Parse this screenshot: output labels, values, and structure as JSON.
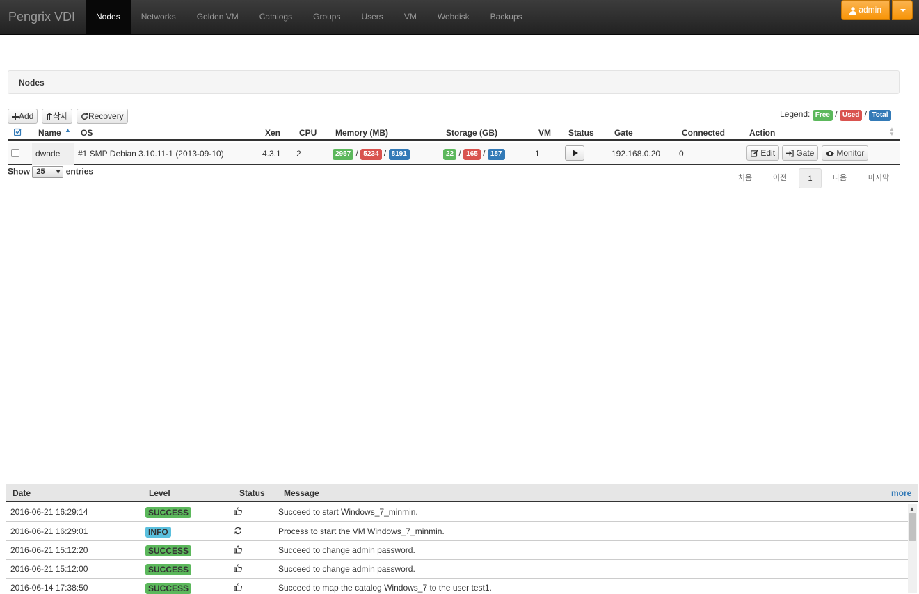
{
  "navbar": {
    "brand": "Pengrix VDI",
    "items": [
      {
        "label": "Nodes",
        "active": true
      },
      {
        "label": "Networks"
      },
      {
        "label": "Golden VM"
      },
      {
        "label": "Catalogs"
      },
      {
        "label": "Groups"
      },
      {
        "label": "Users"
      },
      {
        "label": "VM"
      },
      {
        "label": "Webdisk"
      },
      {
        "label": "Backups"
      }
    ],
    "user_label": "admin"
  },
  "page_title": "Nodes",
  "toolbar": {
    "add_label": "Add",
    "delete_label": "삭제",
    "recovery_label": "Recovery"
  },
  "legend": {
    "label": "Legend:",
    "free": "Free",
    "used": "Used",
    "total": "Total",
    "sep": "/"
  },
  "nodes_table": {
    "columns": [
      "Name",
      "OS",
      "Xen",
      "CPU",
      "Memory (MB)",
      "Storage (GB)",
      "VM",
      "Status",
      "Gate",
      "Connected",
      "Action"
    ],
    "rows": [
      {
        "name": "dwade",
        "os": "#1 SMP Debian 3.10.11-1 (2013-09-10)",
        "xen": "4.3.1",
        "cpu": "2",
        "memory": {
          "free": "2957",
          "used": "5234",
          "total": "8191"
        },
        "storage": {
          "free": "22",
          "used": "165",
          "total": "187"
        },
        "vm": "1",
        "gate": "192.168.0.20",
        "connected": "0",
        "actions": {
          "edit": "Edit",
          "gate": "Gate",
          "monitor": "Monitor"
        }
      }
    ]
  },
  "show_entries": {
    "prefix": "Show",
    "value": "25",
    "suffix": "entries"
  },
  "pagination": {
    "first": "처음",
    "prev": "이전",
    "current": "1",
    "next": "다음",
    "last": "마지막"
  },
  "log": {
    "columns": [
      "Date",
      "Level",
      "Status",
      "Message"
    ],
    "more_label": "more",
    "rows": [
      {
        "date": "2016-06-21 16:29:14",
        "level": "SUCCESS",
        "icon": "thumbs-up-icon",
        "message": "Succeed to start Windows_7_minmin."
      },
      {
        "date": "2016-06-21 16:29:01",
        "level": "INFO",
        "icon": "refresh-icon",
        "message": "Process to start the VM Windows_7_minmin."
      },
      {
        "date": "2016-06-21 15:12:20",
        "level": "SUCCESS",
        "icon": "thumbs-up-icon",
        "message": "Succeed to change admin password."
      },
      {
        "date": "2016-06-21 15:12:00",
        "level": "SUCCESS",
        "icon": "thumbs-up-icon",
        "message": "Succeed to change admin password."
      },
      {
        "date": "2016-06-14 17:38:50",
        "level": "SUCCESS",
        "icon": "thumbs-up-icon",
        "message": "Succeed to map the catalog Windows_7 to the user test1."
      }
    ]
  },
  "colors": {
    "free": "#5cb85c",
    "used": "#d9534f",
    "total": "#337ab7",
    "info": "#5bc0de",
    "admin": "#f89406"
  }
}
